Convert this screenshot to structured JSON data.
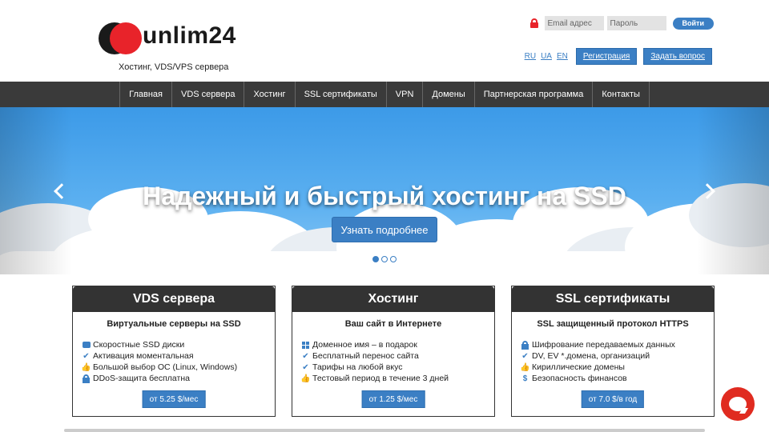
{
  "brand": {
    "name": "unlim24",
    "tagline": "Хостинг, VDS/VPS сервера"
  },
  "login": {
    "email_placeholder": "Email адрес",
    "password_placeholder": "Пароль",
    "submit_label": "Войти"
  },
  "langs": [
    "RU",
    "UA",
    "EN"
  ],
  "header_buttons": {
    "register": "Регистрация",
    "ask": "Задать вопрос"
  },
  "nav": [
    "Главная",
    "VDS сервера",
    "Хостинг",
    "SSL сертификаты",
    "VPN",
    "Домены",
    "Партнерская программа",
    "Контакты"
  ],
  "hero": {
    "title": "Надежный и быстрый хостинг на SSD",
    "button": "Узнать подробнее",
    "slides": 3,
    "active_slide": 1
  },
  "cards": [
    {
      "title": "VDS сервера",
      "subtitle": "Виртуальные серверы на SSD",
      "features": [
        {
          "icon": "disk-icon",
          "text": "Скоростные SSD диски"
        },
        {
          "icon": "check-icon",
          "text": "Активация моментальная"
        },
        {
          "icon": "thumbs-up-icon",
          "text": "Большой выбор ОС (Linux, Windows)"
        },
        {
          "icon": "lock-icon",
          "text": "DDoS-защита бесплатна"
        }
      ],
      "price": "от 5.25 $/мес"
    },
    {
      "title": "Хостинг",
      "subtitle": "Ваш сайт в Интернете",
      "features": [
        {
          "icon": "grid-icon",
          "text": "Доменное имя – в подарок"
        },
        {
          "icon": "check-icon",
          "text": "Бесплатный перенос сайта"
        },
        {
          "icon": "check-icon",
          "text": "Тарифы на любой вкус"
        },
        {
          "icon": "thumbs-up-icon",
          "text": "Тестовый период в течение 3 дней"
        }
      ],
      "price": "от 1.25 $/мес"
    },
    {
      "title": "SSL сертификаты",
      "subtitle": "SSL защищенный протокол HTTPS",
      "features": [
        {
          "icon": "lock-icon",
          "text": "Шифрование передаваемых данных"
        },
        {
          "icon": "check-icon",
          "text": "DV, EV *.домена, организаций"
        },
        {
          "icon": "thumbs-up-icon",
          "text": "Кириллические домены"
        },
        {
          "icon": "dollar-icon",
          "text": "Безопасность финансов"
        }
      ],
      "price": "от 7.0 $/в год"
    }
  ],
  "colors": {
    "accent": "#3b7fc4",
    "nav_bg": "#3a3a3a",
    "logo_red": "#e8232a",
    "chat": "#e02b20"
  }
}
